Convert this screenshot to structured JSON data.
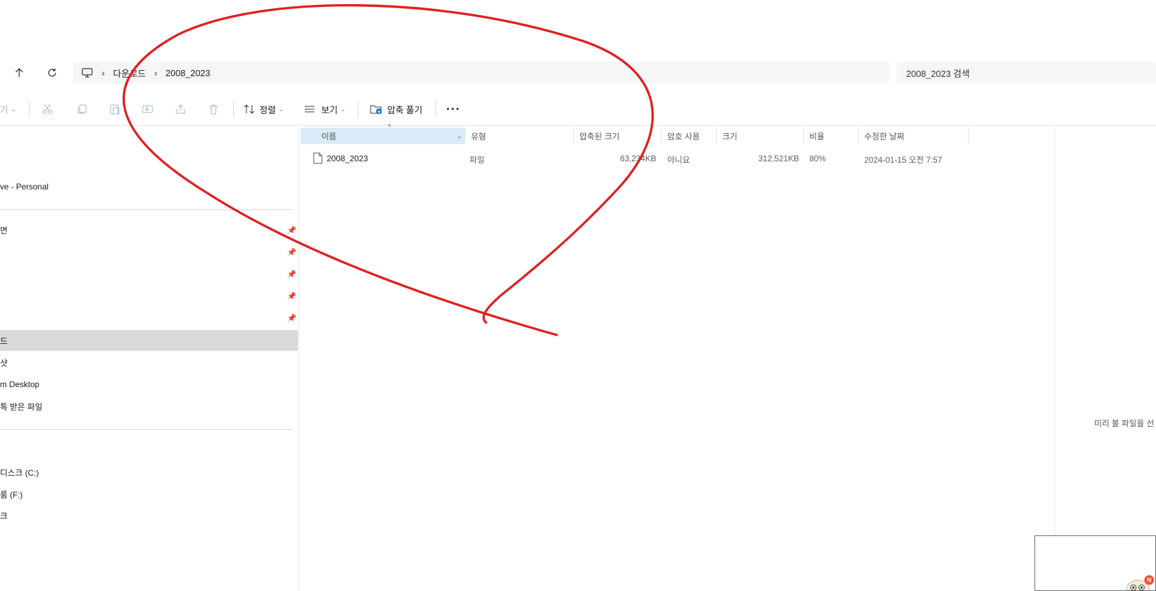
{
  "address": {
    "crumbs": [
      "다운로드",
      "2008_2023"
    ],
    "search_placeholder": "2008_2023 검색"
  },
  "toolbar": {
    "new_label": "기",
    "sort_label": "정렬",
    "view_label": "보기",
    "extract_label": "압축 풀기"
  },
  "sidebar": {
    "onedrive": "ve - Personal",
    "quick_access": [
      {
        "label": "면",
        "pinned": true
      },
      {
        "label": "",
        "pinned": true
      },
      {
        "label": "",
        "pinned": true
      },
      {
        "label": "",
        "pinned": true
      },
      {
        "label": "",
        "pinned": true
      },
      {
        "label": "드",
        "pinned": false,
        "selected": true
      },
      {
        "label": "샷",
        "pinned": false
      },
      {
        "label": "m Desktop",
        "pinned": false
      },
      {
        "label": "톡 받은 파일",
        "pinned": false
      }
    ],
    "drives": [
      {
        "label": "디스크 (C:)"
      },
      {
        "label": "룸 (F:)"
      },
      {
        "label": "크"
      }
    ]
  },
  "columns": {
    "name": "이름",
    "type": "유형",
    "compressed_size": "압축된 크기",
    "password": "암호 사용",
    "size": "크기",
    "ratio": "비율",
    "modified": "수정한 날짜"
  },
  "files": [
    {
      "name": "2008_2023",
      "type": "파일",
      "compressed_size": "63,234KB",
      "password": "아니요",
      "size": "312,521KB",
      "ratio": "80%",
      "modified": "2024-01-15 오전 7:57"
    }
  ],
  "preview": {
    "message": "미리 볼 파일을 선"
  },
  "notification_badge": "N",
  "colors": {
    "annotation": "#e02020",
    "selected_row": "#d9d9d9",
    "sorted_header": "#d9ebf9"
  }
}
